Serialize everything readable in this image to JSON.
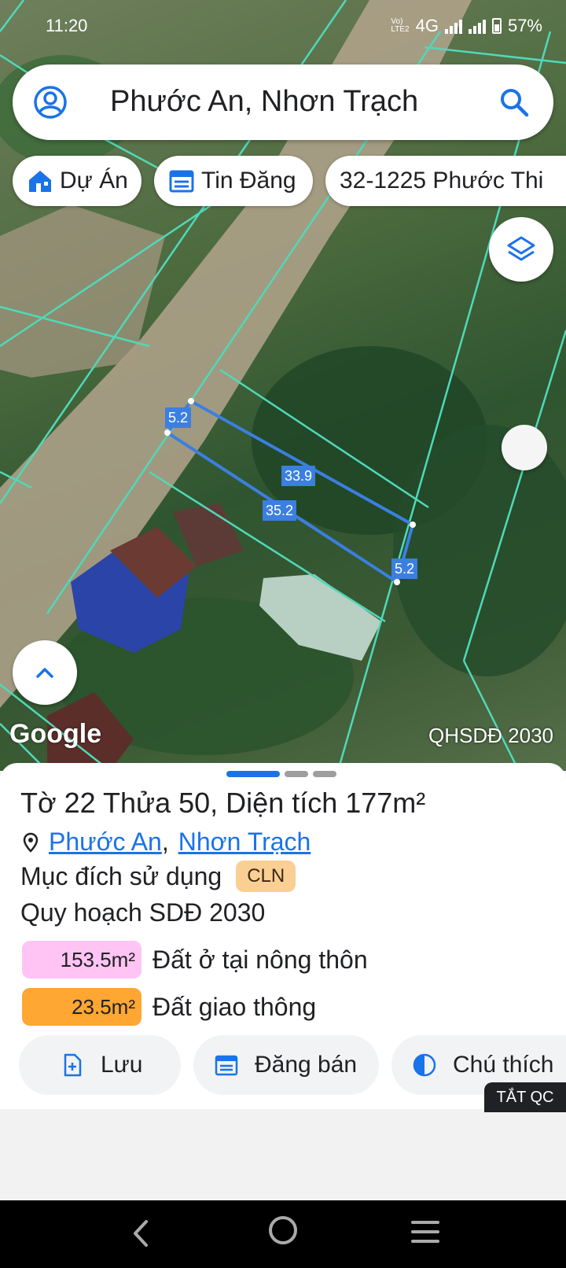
{
  "status_bar": {
    "time": "11:20",
    "volte": "Vo)) LTE2",
    "network": "4G",
    "battery": "57%"
  },
  "search": {
    "query": "Phước An, Nhơn Trạch"
  },
  "chips": [
    {
      "label": "Dự Án",
      "icon": "house-icon"
    },
    {
      "label": "Tin Đăng",
      "icon": "calendar-icon"
    },
    {
      "label": "32-1225 Phước Thi"
    }
  ],
  "map": {
    "attribution": "Google",
    "layer_label": "QHSDĐ 2030",
    "dimensions": [
      "5.2",
      "33.9",
      "35.2",
      "5.2"
    ],
    "colors": {
      "parcel_line": "#4fd9b8",
      "selected_parcel": "#3b7fe0"
    }
  },
  "sheet": {
    "title": "Tờ 22 Thửa 50, Diện tích 177m²",
    "location": {
      "ward": "Phước An",
      "separator": ",",
      "district": "Nhơn Trạch"
    },
    "purpose_label": "Mục đích sử dụng",
    "purpose_code": "CLN",
    "plan_title": "Quy hoạch SDĐ 2030",
    "zones": [
      {
        "area": "153.5m²",
        "label": "Đất ở tại nông thôn",
        "color": "#ffc4f4"
      },
      {
        "area": "23.5m²",
        "label": "Đất giao thông",
        "color": "#ffa633"
      }
    ],
    "actions": [
      {
        "label": "Lưu",
        "icon": "save-file-icon"
      },
      {
        "label": "Đăng bán",
        "icon": "calendar-icon"
      },
      {
        "label": "Chú thích",
        "icon": "contrast-icon"
      }
    ],
    "ad_toggle": "TẮT QC"
  }
}
